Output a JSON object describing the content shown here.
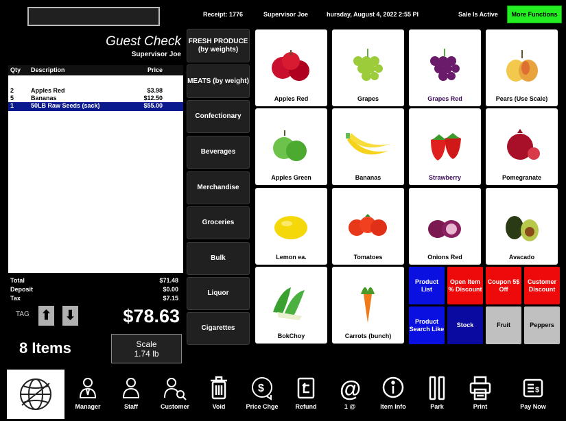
{
  "topbar": {
    "receipt": "Receipt: 1776",
    "user": "Supervisor Joe",
    "datetime": "hursday, August 4, 2022  2:55 PI",
    "status": "Sale Is Active",
    "more_functions": "More Functions"
  },
  "guest_check": {
    "title": "Guest Check",
    "user": "Supervisor Joe",
    "headers": {
      "qty": "Qty",
      "description": "Description",
      "price": "Price"
    },
    "lines": [
      {
        "qty": "2",
        "description": "Apples Red",
        "price": "$3.98",
        "selected": false
      },
      {
        "qty": "5",
        "description": "Bananas",
        "price": "$12.50",
        "selected": false
      },
      {
        "qty": "1",
        "description": "50LB Raw Seeds (sack)",
        "price": "$55.00",
        "selected": true
      }
    ]
  },
  "totals": {
    "total_label": "Total",
    "total_value": "$71.48",
    "deposit_label": "Deposit",
    "deposit_value": "$0.00",
    "tax_label": "Tax",
    "tax_value": "$7.15",
    "grand_total": "$78.63",
    "tag_label": "TAG",
    "items_count": "8 Items",
    "scale_label": "Scale",
    "scale_value": "1.74 lb"
  },
  "categories": [
    "FRESH PRODUCE (by weights)",
    "MEATS  (by weight)",
    "Confectionary",
    "Beverages",
    "Merchandise",
    "Groceries",
    "Bulk",
    "Liquor",
    "Cigarettes"
  ],
  "products": [
    "Apples Red",
    "Grapes",
    "Grapes Red",
    "Pears (Use Scale)",
    "Apples Green",
    "Bananas",
    "Strawberry",
    "Pomegranate",
    "Lemon ea.",
    "Tomatoes",
    "Onions Red",
    "Avacado",
    "BokChoy",
    "Carrots (bunch)"
  ],
  "function_buttons": {
    "product_list": "Product List",
    "open_item_discount": "Open Item % Discount",
    "coupon": "Coupon 5$ Off",
    "customer_discount": "Customer Discount",
    "product_search": "Product Search Like",
    "stock": "Stock",
    "fruit": "Fruit",
    "peppers": "Peppers"
  },
  "bottom_bar": [
    "Manager",
    "Staff",
    "Customer",
    "Void",
    "Price Chge",
    "Refund",
    "1 @",
    "Item Info",
    "Park",
    "Print",
    "Pay Now"
  ],
  "colors": {
    "more_functions": "#22ee22",
    "selected_row": "#0a1a8e",
    "blue_button": "#0a10e0",
    "red_button": "#ee0a0a",
    "gray_button": "#c0c0c0"
  }
}
